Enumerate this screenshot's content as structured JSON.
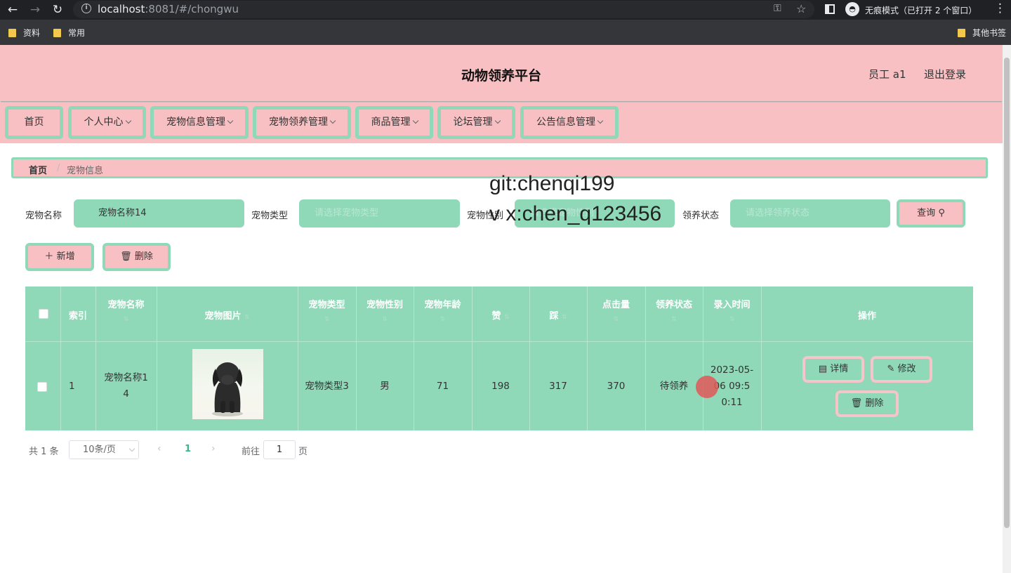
{
  "browser": {
    "url_host": "localhost",
    "url_rest": ":8081/#/chongwu",
    "incognito_text": "无痕模式（已打开 2 个窗口）",
    "bookmarks": [
      "资料",
      "常用"
    ],
    "other_bookmarks": "其他书签"
  },
  "header": {
    "title": "动物领养平台",
    "user": "员工 a1",
    "logout": "退出登录"
  },
  "nav": [
    {
      "label": "首页",
      "dropdown": false
    },
    {
      "label": "个人中心",
      "dropdown": true
    },
    {
      "label": "宠物信息管理",
      "dropdown": true
    },
    {
      "label": "宠物领养管理",
      "dropdown": true
    },
    {
      "label": "商品管理",
      "dropdown": true
    },
    {
      "label": "论坛管理",
      "dropdown": true
    },
    {
      "label": "公告信息管理",
      "dropdown": true
    }
  ],
  "breadcrumb": {
    "home": "首页",
    "sep": "/",
    "current": "宠物信息"
  },
  "watermark": {
    "line1": "git:chenqi199",
    "line2": "v x:chen_q123456"
  },
  "search": {
    "name_label": "宠物名称",
    "name_value": "宠物名称14",
    "type_label": "宠物类型",
    "type_placeholder": "请选择宠物类型",
    "sex_label": "宠物性别",
    "sex_placeholder": "请选择宠物性别",
    "status_label": "领养状态",
    "status_placeholder": "请选择领养状态",
    "query_label": "查询"
  },
  "actions": {
    "add_label": "新增",
    "delete_label": "删除"
  },
  "table": {
    "headers": [
      "索引",
      "宠物名称",
      "宠物图片",
      "宠物类型",
      "宠物性别",
      "宠物年龄",
      "赞",
      "踩",
      "点击量",
      "领养状态",
      "录入时间",
      "操作"
    ],
    "rows": [
      {
        "index": "1",
        "name": "宠物名称14",
        "type": "宠物类型3",
        "sex": "男",
        "age": "71",
        "likes": "198",
        "dislikes": "317",
        "clicks": "370",
        "status": "待领养",
        "time": "2023-05-06 09:50:11"
      }
    ],
    "row_actions": {
      "detail": "详情",
      "edit": "修改",
      "delete": "删除"
    }
  },
  "pagination": {
    "total": "共 1 条",
    "page_size": "10条/页",
    "current_page": "1",
    "goto_label": "前往",
    "goto_value": "1",
    "page_suffix": "页"
  },
  "colors": {
    "pink": "#f8c0c3",
    "mint": "#8fd8b8"
  }
}
